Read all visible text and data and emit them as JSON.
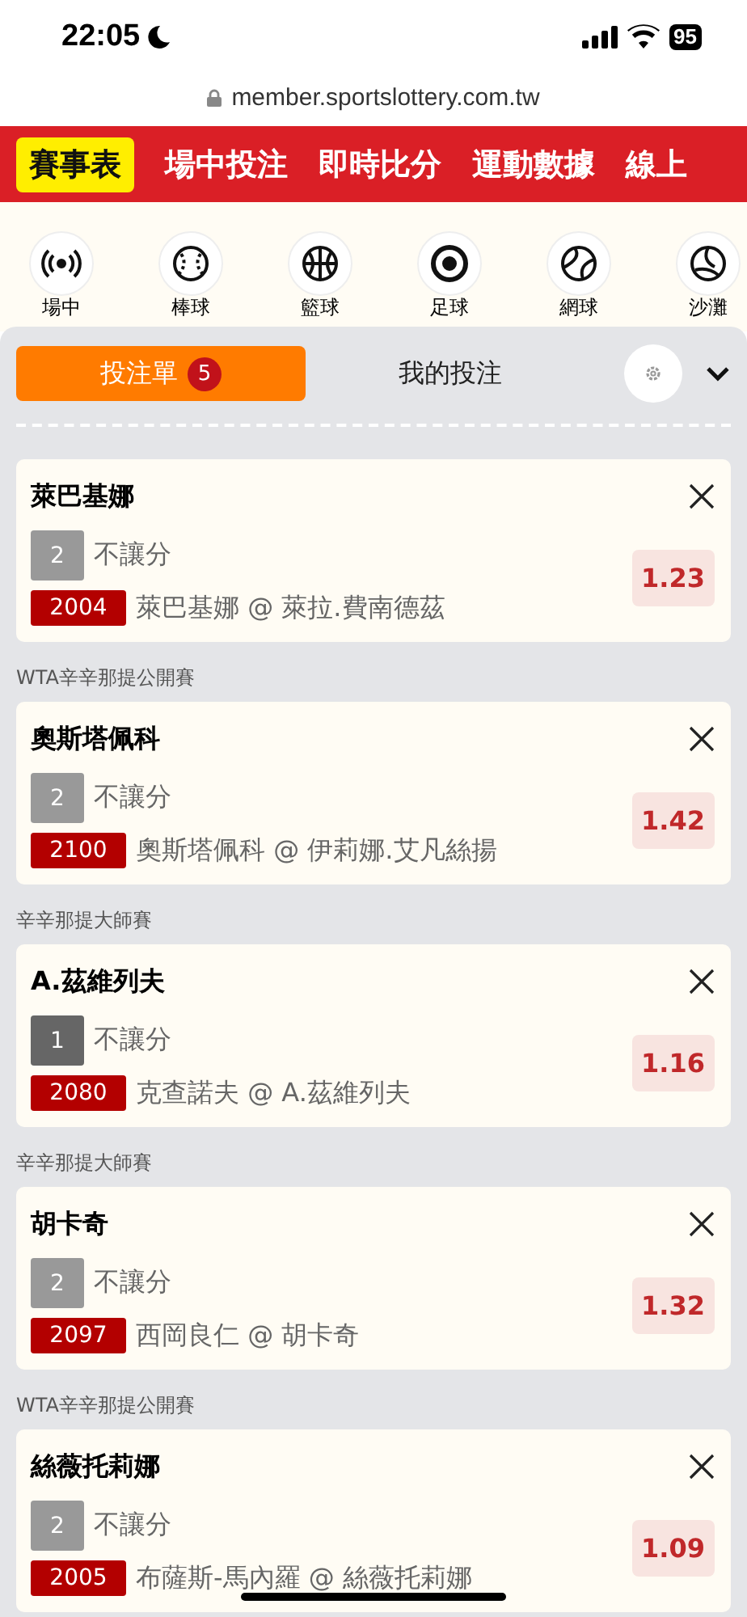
{
  "status_bar": {
    "time": "22:05",
    "battery": "95"
  },
  "url": "member.sportslottery.com.tw",
  "nav": [
    {
      "label": "賽事表",
      "selected": true
    },
    {
      "label": "場中投注",
      "selected": false
    },
    {
      "label": "即時比分",
      "selected": false
    },
    {
      "label": "運動數據",
      "selected": false
    },
    {
      "label": "線上",
      "selected": false
    }
  ],
  "sports": [
    {
      "label": "場中",
      "kind": "live"
    },
    {
      "label": "棒球",
      "kind": "baseball"
    },
    {
      "label": "籃球",
      "kind": "basketball"
    },
    {
      "label": "足球",
      "kind": "soccer"
    },
    {
      "label": "網球",
      "kind": "tennis"
    },
    {
      "label": "沙灘",
      "kind": "volleyball"
    }
  ],
  "tabs": [
    {
      "label": "投注單",
      "badge": "5",
      "selected": true
    },
    {
      "label": "我的投注",
      "selected": false
    }
  ],
  "bets": [
    {
      "title": "萊巴基娜",
      "line": "2",
      "dark": false,
      "market": "不讓分",
      "code": "2004",
      "match": "萊巴基娜 @ 萊拉.費南德茲",
      "odds": "1.23"
    },
    {
      "league": "WTA辛辛那提公開賽",
      "title": "奧斯塔佩科",
      "line": "2",
      "dark": false,
      "market": "不讓分",
      "code": "2100",
      "match": "奧斯塔佩科 @ 伊莉娜.艾凡絲揚",
      "odds": "1.42"
    },
    {
      "league": "辛辛那提大師賽",
      "title": "A.茲維列夫",
      "line": "1",
      "dark": true,
      "market": "不讓分",
      "code": "2080",
      "match": "克查諾夫 @ A.茲維列夫",
      "odds": "1.16"
    },
    {
      "league": "辛辛那提大師賽",
      "title": "胡卡奇",
      "line": "2",
      "dark": false,
      "market": "不讓分",
      "code": "2097",
      "match": "西岡良仁 @ 胡卡奇",
      "odds": "1.32"
    },
    {
      "league": "WTA辛辛那提公開賽",
      "title": "絲薇托莉娜",
      "line": "2",
      "dark": false,
      "market": "不讓分",
      "code": "2005",
      "match": "布薩斯-馬內羅 @ 絲薇托莉娜",
      "odds": "1.09"
    }
  ]
}
